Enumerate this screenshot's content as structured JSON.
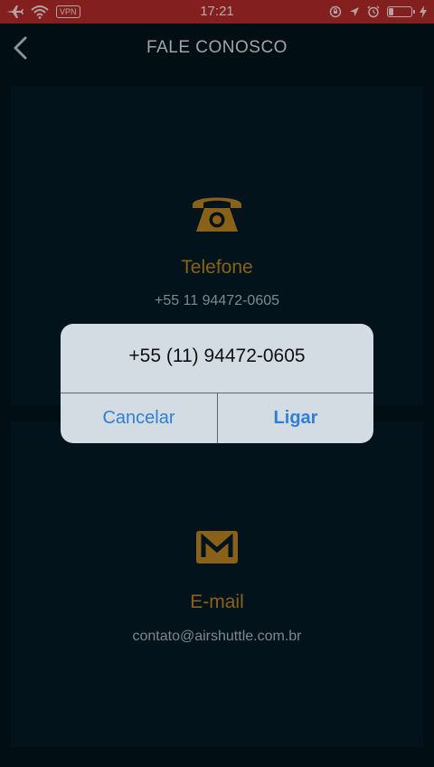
{
  "status_bar": {
    "vpn": "VPN",
    "time": "17:21",
    "battery_level": 0.2
  },
  "nav": {
    "title": "FALE CONOSCO",
    "back_icon": "chevron-left-icon"
  },
  "contacts": {
    "phone": {
      "icon": "telephone-icon",
      "label": "Telefone",
      "value": "+55 11 94472-0605"
    },
    "email": {
      "icon": "envelope-icon",
      "label": "E-mail",
      "value": "contato@airshuttle.com.br"
    }
  },
  "alert": {
    "title": "+55 (11) 94472-0605",
    "cancel_label": "Cancelar",
    "call_label": "Ligar"
  },
  "colors": {
    "status_bar": "#b02a2a",
    "background": "#02141d",
    "accent": "#b88220",
    "alert_button": "#2f7fd6"
  }
}
